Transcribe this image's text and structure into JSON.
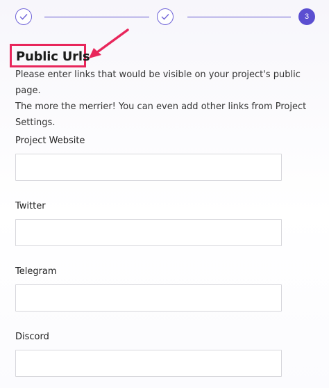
{
  "stepper": {
    "steps": [
      {
        "state": "completed",
        "icon": "check-icon"
      },
      {
        "state": "completed",
        "icon": "check-icon"
      },
      {
        "state": "active",
        "number": "3"
      }
    ],
    "accent_color": "#5b4fd1"
  },
  "section": {
    "title": "Public Urls",
    "description_line1": "Please enter links that would be visible on your project's public page.",
    "description_line2": "The more the merrier! You can even add other links from Project",
    "description_line3": "Settings."
  },
  "annotation": {
    "highlight_color": "#e8265b",
    "arrow_icon": "arrow-pointer-icon"
  },
  "fields": {
    "website": {
      "label": "Project Website",
      "value": "",
      "placeholder": ""
    },
    "twitter": {
      "label": "Twitter",
      "value": "",
      "placeholder": ""
    },
    "telegram": {
      "label": "Telegram",
      "value": "",
      "placeholder": ""
    },
    "discord": {
      "label": "Discord",
      "value": "",
      "placeholder": ""
    }
  }
}
